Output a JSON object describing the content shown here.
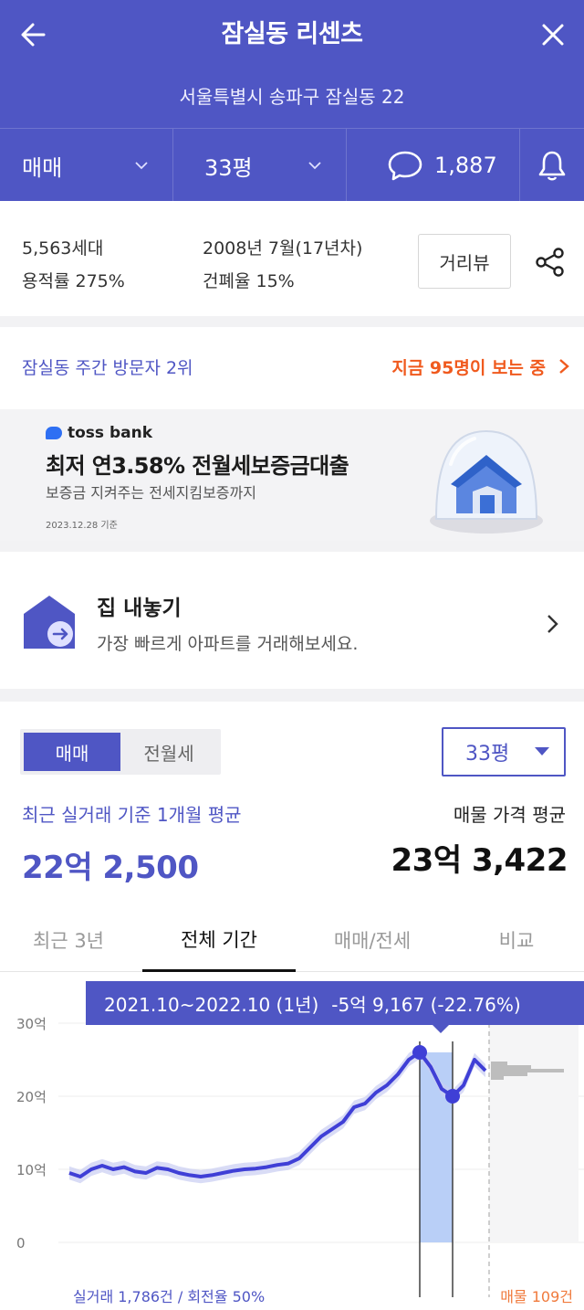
{
  "header": {
    "title": "잠실동 리센츠",
    "address": "서울특별시 송파구 잠실동 22",
    "trade_type": "매매",
    "size": "33평",
    "comment_count": "1,887"
  },
  "info": {
    "households": "5,563세대",
    "floor_area_ratio": "용적률 275%",
    "built": "2008년 7월(17년차)",
    "building_coverage": "건폐율 15%",
    "street_view_button": "거리뷰"
  },
  "visitors": {
    "rank_text": "잠실동 주간 방문자 2위",
    "now_viewing": "지금 95명이 보는 중"
  },
  "ad": {
    "brand": "toss bank",
    "title": "최저 연3.58% 전월세보증금대출",
    "subtitle": "보증금 지켜주는 전세지킴보증까지",
    "date": "2023.12.28 기준"
  },
  "list_home": {
    "title": "집 내놓기",
    "subtitle": "가장 빠르게 아파트를 거래해보세요."
  },
  "price": {
    "segment": [
      "매매",
      "전월세"
    ],
    "size_select": "33평",
    "recent_avg_label": "최근 실거래 기준 1개월 평균",
    "recent_avg_value": "22억 2,500",
    "listing_avg_label": "매물 가격 평균",
    "listing_avg_value": "23억 3,422",
    "tabs": [
      "최근 3년",
      "전체 기간",
      "매매/전세",
      "비교"
    ]
  },
  "chart_data": {
    "type": "line",
    "y_ticks": [
      "30억",
      "20억",
      "10억",
      "0"
    ],
    "ylim": [
      0,
      30
    ],
    "tooltip_period": "2021.10~2022.10 (1년)",
    "tooltip_change": "-5억 9,167 (-22.76%)",
    "trade_count_label": "실거래 1,786건 / 회전율 50%",
    "listing_count_label": "매물 109건",
    "series": [
      {
        "values": [
          9.5,
          9.0,
          10.0,
          10.5,
          10.0,
          10.3,
          9.7,
          9.5,
          10.2,
          10.0,
          9.5,
          9.2,
          9.0,
          9.2,
          9.5,
          9.8,
          10.0,
          10.1,
          10.3,
          10.6,
          10.8,
          11.5,
          13.0,
          14.5,
          15.5,
          16.5,
          18.5,
          19.0,
          20.5,
          21.5,
          23.0,
          25.0,
          26.0,
          24.0,
          21.0,
          20.0,
          21.5,
          25.0,
          23.5
        ]
      }
    ],
    "highlight": {
      "start_value": 26.0,
      "end_value": 20.0
    },
    "listing_histogram": [
      22.5,
      23.0,
      23.5,
      24.0,
      24.5
    ]
  }
}
